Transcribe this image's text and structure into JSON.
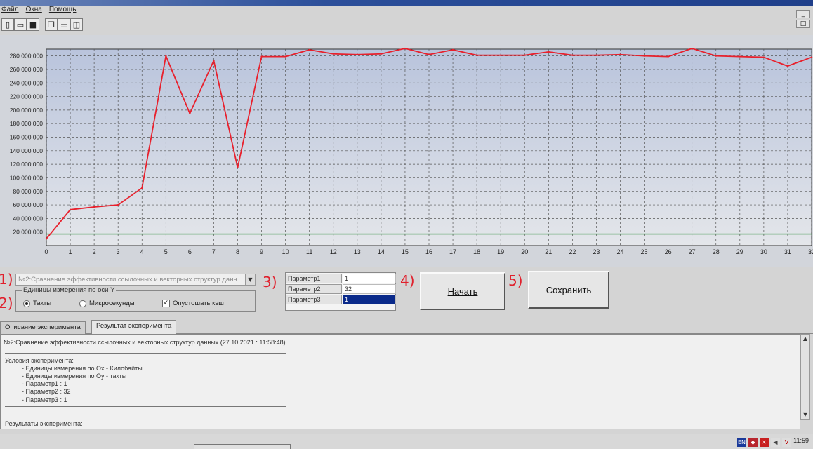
{
  "menu": [
    "Файл",
    "Окна",
    "Помощь"
  ],
  "toolbar_icons": [
    "new-file-icon",
    "open-folder-icon",
    "save-icon",
    "window-cascade-icon",
    "window-tile-icon",
    "window-split-icon"
  ],
  "window_controls": [
    "_",
    "□"
  ],
  "chart_data": {
    "type": "line",
    "x": [
      0,
      1,
      2,
      3,
      4,
      5,
      6,
      7,
      8,
      9,
      10,
      11,
      12,
      13,
      14,
      15,
      16,
      17,
      18,
      19,
      20,
      21,
      22,
      23,
      24,
      25,
      26,
      27,
      28,
      29,
      30,
      31,
      32
    ],
    "series": [
      {
        "values": [
          10000000,
          53000000,
          57000000,
          60000000,
          85000000,
          280000000,
          195000000,
          273000000,
          115000000,
          279000000,
          279000000,
          289000000,
          283000000,
          282000000,
          283000000,
          291000000,
          282000000,
          289000000,
          281000000,
          281000000,
          281000000,
          286000000,
          281000000,
          281000000,
          282000000,
          280000000,
          279000000,
          291000000,
          280000000,
          279000000,
          278000000,
          265000000,
          278000000
        ],
        "color": "#e8202c"
      }
    ],
    "ylim": [
      0,
      290000000
    ],
    "xlim": [
      0,
      32
    ],
    "y_ticks": [
      "20 000 000",
      "40 000 000",
      "60 000 000",
      "80 000 000",
      "100 000 000",
      "120 000 000",
      "140 000 000",
      "160 000 000",
      "180 000 000",
      "200 000 000",
      "220 000 000",
      "240 000 000",
      "260 000 000",
      "280 000 000"
    ],
    "x_ticks": [
      "0",
      "1",
      "2",
      "3",
      "4",
      "5",
      "6",
      "7",
      "8",
      "9",
      "10",
      "11",
      "12",
      "13",
      "14",
      "15",
      "16",
      "17",
      "18",
      "19",
      "20",
      "21",
      "22",
      "23",
      "24",
      "25",
      "26",
      "27",
      "28",
      "29",
      "30",
      "31",
      "32"
    ],
    "grid": true,
    "reference_line": {
      "value": 17000000,
      "color": "#2a8a3a"
    }
  },
  "markers": [
    "1)",
    "2)",
    "3)",
    "4)",
    "5)"
  ],
  "experiment_select": {
    "value": "№2:Сравнение эффективности ссылочных и векторных структур данн"
  },
  "units_group": {
    "title": "Единицы измерения по оси Y",
    "radio_ticks": "Такты",
    "radio_micro": "Микросекунды",
    "checkbox_cache": "Опустошать кэш",
    "selected": "Такты",
    "cache_checked": true
  },
  "params": [
    {
      "name": "Параметр1",
      "value": "1"
    },
    {
      "name": "Параметр2",
      "value": "32"
    },
    {
      "name": "Параметр3",
      "value": "1"
    }
  ],
  "buttons": {
    "start": "Начать",
    "save": "Сохранить"
  },
  "tabs": [
    "Описание эксперимента",
    "Результат эксперимента"
  ],
  "active_tab": "Результат эксперимента",
  "result": {
    "header": "№2:Сравнение эффективности ссылочных и векторных структур данных (27.10.2021 : 11:58:48)",
    "conditions_title": "Условия эксперимента:",
    "lines": [
      "- Единицы измерения по Ox - Килобайты",
      "- Единицы измерения по Oy - такты",
      "- Параметр1   :   1",
      "- Параметр2   :   32",
      "- Параметр3   :   1"
    ],
    "results_title": "Результаты эксперимента:"
  },
  "taskbar": {
    "language": "EN",
    "clock": "11:59"
  },
  "colors": {
    "plot_bg_top": "#b9c4dc",
    "plot_bg_bottom": "#e4e6ea",
    "line": "#e8202c",
    "markers": "#e0202c"
  }
}
